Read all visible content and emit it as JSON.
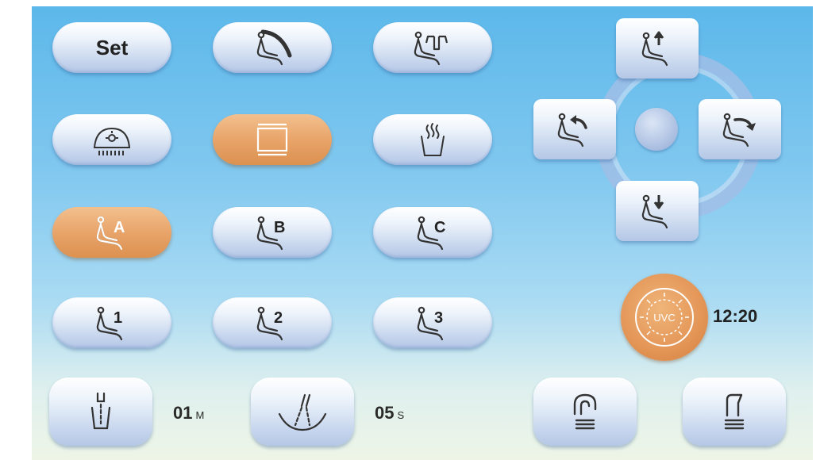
{
  "buttons": {
    "set_label": "Set",
    "memory_a": "A",
    "memory_b": "B",
    "memory_c": "C",
    "memory_1": "1",
    "memory_2": "2",
    "memory_3": "3"
  },
  "icons": {
    "row1": [
      "chair-recline-icon",
      "chair-lift-icon"
    ],
    "row2": [
      "operating-light-icon",
      "monitor-icon",
      "cup-warm-icon"
    ],
    "dpad": [
      "chair-up-icon",
      "chair-back-left-icon",
      "chair-back-right-icon",
      "chair-down-icon"
    ],
    "bottom": [
      "cup-fill-icon",
      "bowl-rinse-icon",
      "instrument-hose-icon",
      "instrument-holder-icon"
    ]
  },
  "active_states": {
    "monitor": true,
    "memory_a": true
  },
  "timers": {
    "cup_fill_value": "01",
    "cup_fill_unit": "M",
    "bowl_rinse_value": "05",
    "bowl_rinse_unit": "S",
    "uvc_label": "UVC",
    "uvc_time": "12:20"
  },
  "colors": {
    "accent_orange": "#e39a5c",
    "button_face": "#dbe5f4",
    "background_top": "#5cb8ea",
    "background_bottom": "#eef5e6"
  }
}
